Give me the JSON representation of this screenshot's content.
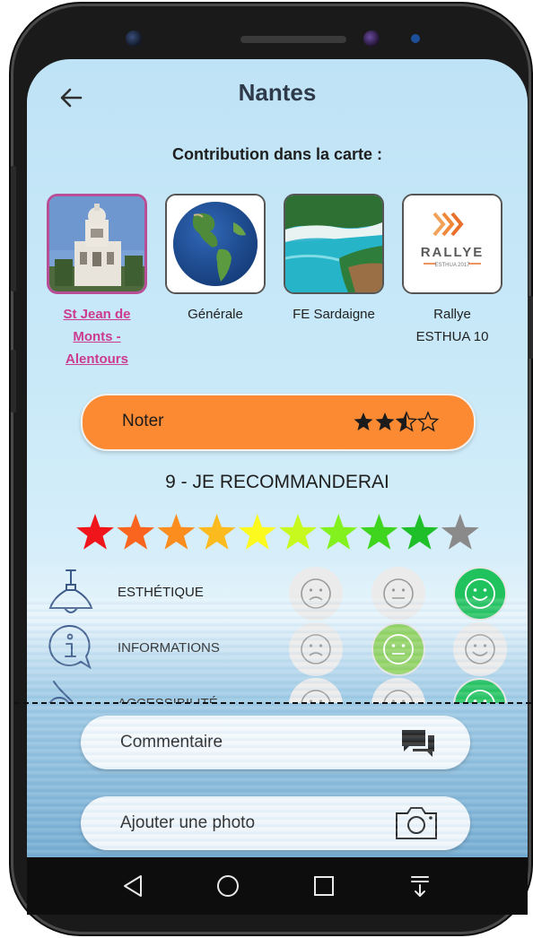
{
  "header": {
    "title": "Nantes",
    "back_icon": "arrow-left-icon"
  },
  "contribution": {
    "title": "Contribution dans la carte :",
    "maps": [
      {
        "label": "St Jean de Monts - Alentours",
        "label_lines": [
          "St Jean de",
          "Monts -",
          "Alentours"
        ],
        "selected": true,
        "image": "building-photo"
      },
      {
        "label": "Générale",
        "label_lines": [
          "Générale"
        ],
        "selected": false,
        "image": "globe-photo"
      },
      {
        "label": "FE Sardaigne",
        "label_lines": [
          "FE Sardaigne"
        ],
        "selected": false,
        "image": "beach-photo"
      },
      {
        "label": "Rallye ESTHUA 10",
        "label_lines": [
          "Rallye",
          "ESTHUA 10"
        ],
        "selected": false,
        "image": "rallye-logo",
        "logo_text": "RALLYE",
        "logo_subtext": "ESTHUA 2017"
      }
    ]
  },
  "rating": {
    "button_label": "Noter",
    "stars_display": "2.5 of 5",
    "stars_text": "★★⯪☆",
    "recommend_text": "9 - JE RECOMMANDERAI",
    "score": 9,
    "max": 10,
    "star_colors": [
      "#f0151b",
      "#f9651e",
      "#fb8c1e",
      "#fbba1e",
      "#fbf91e",
      "#c7f91e",
      "#83f11e",
      "#3fd51e",
      "#1fbf2a",
      "#8a8a8a"
    ]
  },
  "criteria": [
    {
      "label": "ESTHÉTIQUE",
      "icon": "lamp-icon",
      "selected": "happy"
    },
    {
      "label": "INFORMATIONS",
      "icon": "info-bubble-icon",
      "selected": "neutral"
    },
    {
      "label": "ACCESSIBILITÉ",
      "icon": "accessibility-icon",
      "selected": "happy"
    }
  ],
  "actions": {
    "comment_label": "Commentaire",
    "comment_icon": "chat-bubbles-icon",
    "photo_label": "Ajouter une photo",
    "photo_icon": "camera-icon"
  },
  "colors": {
    "accent_orange": "#fb8a33",
    "selected_border": "#b84f96",
    "link_pink": "#cc3b8f",
    "happy_green": "#1fc25c",
    "neutral_green": "#8fd25f",
    "face_gray": "#ebebeb"
  },
  "navbar": {
    "icons": [
      "back-triangle-icon",
      "home-circle-icon",
      "recents-square-icon",
      "notification-pulldown-icon"
    ]
  }
}
